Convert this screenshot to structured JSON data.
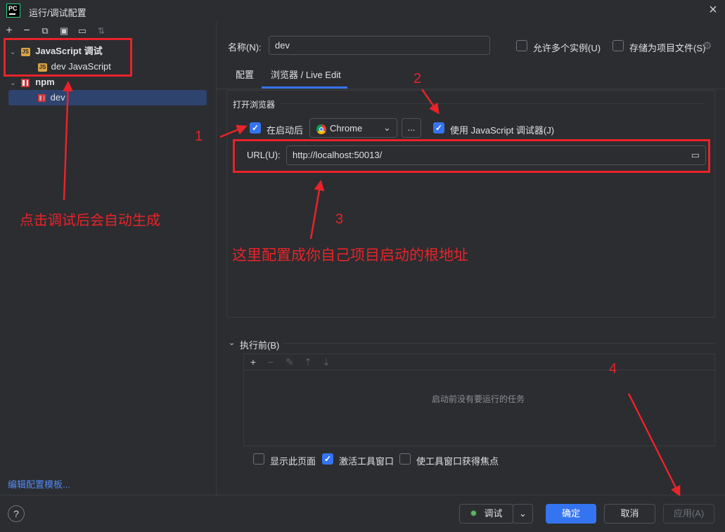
{
  "window": {
    "title": "运行/调试配置",
    "logo_text": "PC"
  },
  "toolbar": {
    "icons": [
      "add-icon",
      "remove-icon",
      "copy-icon",
      "save-icon",
      "folder-add-icon",
      "sort-icon"
    ]
  },
  "tree": {
    "group_js": "JavaScript 调试",
    "item_js": "dev JavaScript",
    "group_npm": "npm",
    "item_npm": "dev",
    "js_badge": "JS"
  },
  "edit_templates_link": "编辑配置模板...",
  "name_field": {
    "label": "名称(N):",
    "value": "dev"
  },
  "allow_multiple": {
    "label": "允许多个实例(U)",
    "checked": false
  },
  "store_as_project_file": {
    "label": "存储为项目文件(S)",
    "checked": false
  },
  "tabs": [
    {
      "label": "配置",
      "active": false
    },
    {
      "label": "浏览器 / Live Edit",
      "active": true
    }
  ],
  "open_browser": {
    "section_title": "打开浏览器",
    "after_launch": {
      "label": "在启动后",
      "checked": true
    },
    "browser_select": "Chrome",
    "more_button": "...",
    "use_js_debugger": {
      "label": "使用 JavaScript 调试器(J)",
      "checked": true
    },
    "url_label": "URL(U):",
    "url_value": "http://localhost:50013/"
  },
  "before_launch": {
    "title": "执行前(B)",
    "empty_text": "启动前没有要运行的任务"
  },
  "bottom_options": [
    {
      "label": "显示此页面",
      "checked": false
    },
    {
      "label": "激活工具窗口",
      "checked": true
    },
    {
      "label": "使工具窗口获得焦点",
      "checked": false
    }
  ],
  "buttons": {
    "debug": "调试",
    "ok": "确定",
    "cancel": "取消",
    "apply": "应用(A)",
    "help": "?"
  },
  "annotations": {
    "auto_gen_note": "点击调试后会自动生成",
    "config_note": "这里配置成你自己项目启动的根地址",
    "num1": "1",
    "num2": "2",
    "num3": "3",
    "num4": "4",
    "color": "#e8232a"
  }
}
